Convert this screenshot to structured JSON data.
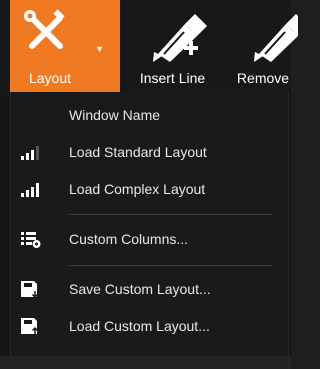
{
  "toolbar": {
    "layout": {
      "label": "Layout",
      "icon": "wrench-screwdriver-icon",
      "accent": "#f07a22"
    },
    "insert_line": {
      "label": "Insert Line",
      "icon": "pen-plus-icon"
    },
    "remove": {
      "label": "Remove",
      "icon": "pen-remove-icon"
    }
  },
  "menu": {
    "header": "Window Name",
    "items": [
      {
        "label": "Load Standard Layout",
        "icon": "signal-bars-medium-icon"
      },
      {
        "label": "Load Complex Layout",
        "icon": "signal-bars-full-icon"
      },
      {
        "label": "Custom Columns...",
        "icon": "columns-gear-icon"
      },
      {
        "label": "Save Custom Layout...",
        "icon": "save-layout-icon"
      },
      {
        "label": "Load Custom Layout...",
        "icon": "load-layout-icon"
      }
    ]
  }
}
